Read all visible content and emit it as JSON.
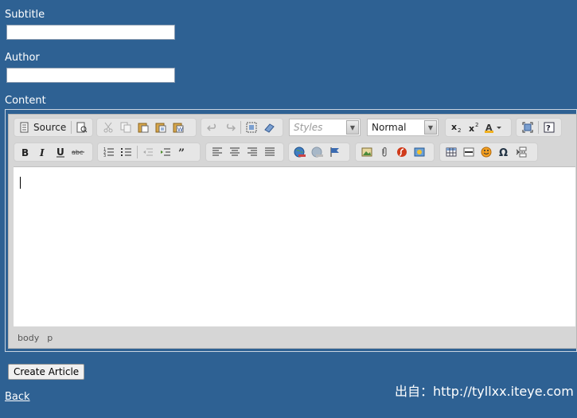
{
  "form": {
    "subtitle_label": "Subtitle",
    "subtitle_value": "",
    "author_label": "Author",
    "author_value": "",
    "content_label": "Content"
  },
  "editor": {
    "source_label": "Source",
    "styles_placeholder": "Styles",
    "format_value": "Normal",
    "path": [
      "body",
      "p"
    ]
  },
  "actions": {
    "create_label": "Create Article",
    "back_label": "Back"
  },
  "watermark": "出自：http://tyllxx.iteye.com"
}
